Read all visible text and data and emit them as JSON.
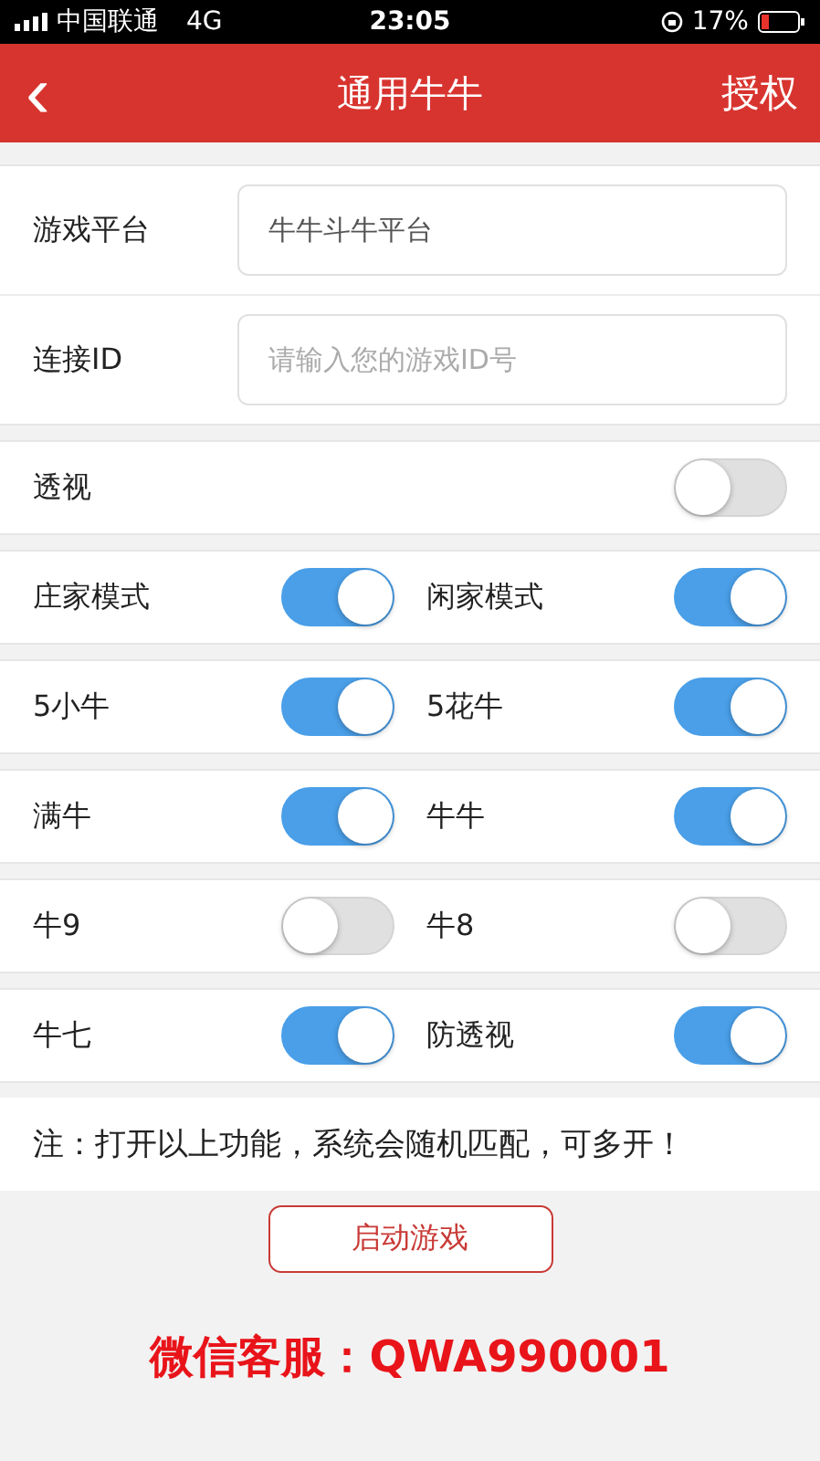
{
  "status_bar": {
    "carrier": "中国联通",
    "network": "4G",
    "time": "23:05",
    "battery": "17%"
  },
  "nav": {
    "back": "‹",
    "title": "通用牛牛",
    "action": "授权"
  },
  "fields": [
    {
      "label": "游戏平台",
      "value": "牛牛斗牛平台"
    },
    {
      "label": "连接ID",
      "placeholder": "请输入您的游戏ID号"
    }
  ],
  "single_toggle": {
    "label": "透视",
    "on": false
  },
  "toggle_rows": [
    [
      {
        "label": "庄家模式",
        "on": true
      },
      {
        "label": "闲家模式",
        "on": true
      }
    ],
    [
      {
        "label": "5小牛",
        "on": true
      },
      {
        "label": "5花牛",
        "on": true
      }
    ],
    [
      {
        "label": "满牛",
        "on": true
      },
      {
        "label": "牛牛",
        "on": true
      }
    ],
    [
      {
        "label": "牛9",
        "on": false
      },
      {
        "label": "牛8",
        "on": false
      }
    ],
    [
      {
        "label": "牛七",
        "on": true
      },
      {
        "label": "防透视",
        "on": true
      }
    ]
  ],
  "note": "注：打开以上功能，系统会随机匹配，可多开！",
  "start_button": "启动游戏",
  "contact": "微信客服：QWA990001"
}
